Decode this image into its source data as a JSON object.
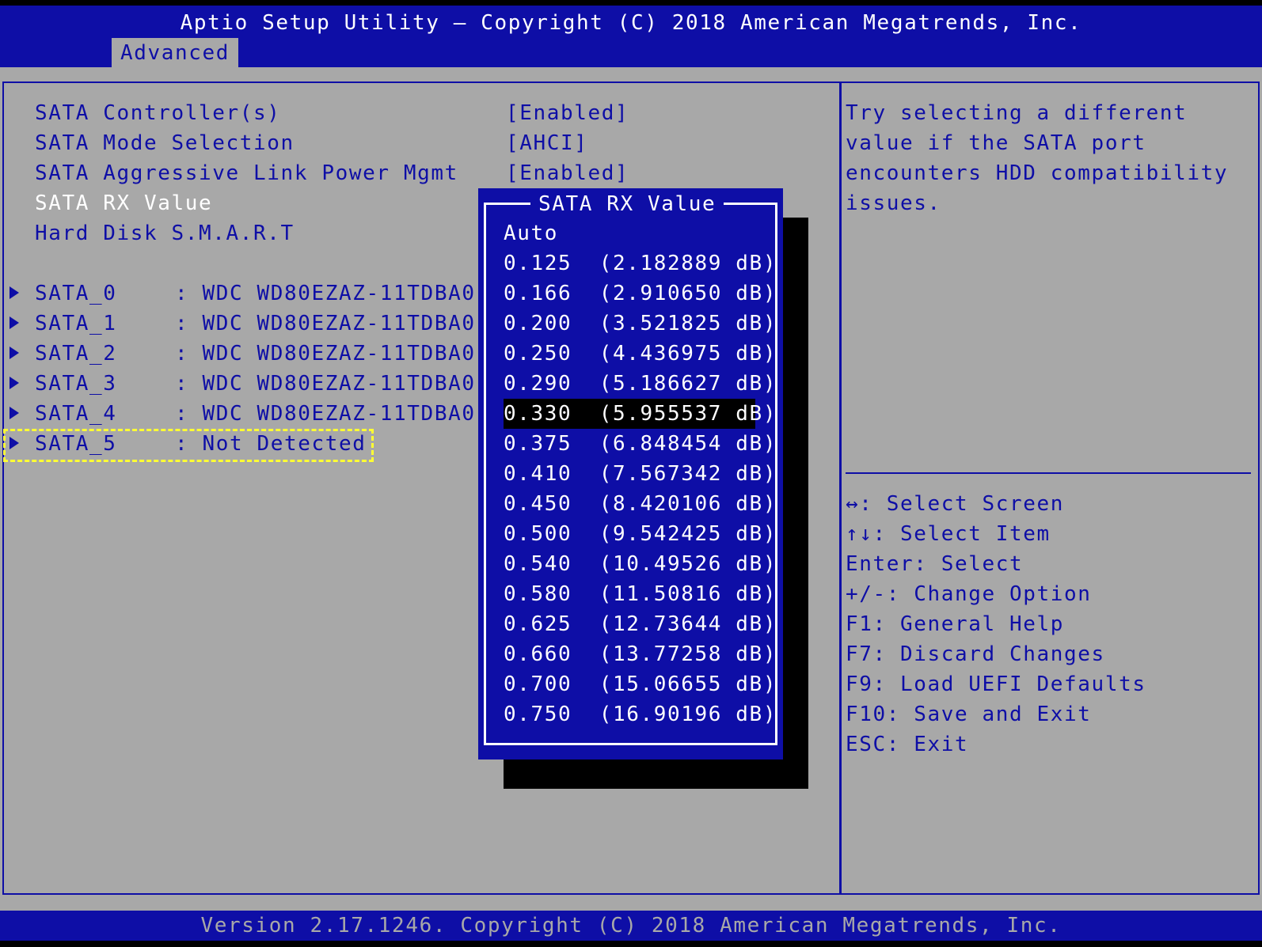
{
  "header": {
    "title": "Aptio Setup Utility – Copyright (C) 2018 American Megatrends, Inc.",
    "tab": "Advanced"
  },
  "settings": [
    {
      "label": "SATA Controller(s)",
      "value": "[Enabled]"
    },
    {
      "label": "SATA Mode Selection",
      "value": "[AHCI]"
    },
    {
      "label": "SATA Aggressive Link Power Mgmt",
      "value": "[Enabled]"
    },
    {
      "label": "SATA RX Value",
      "value": ""
    },
    {
      "label": "Hard Disk S.M.A.R.T",
      "value": ""
    }
  ],
  "ports": [
    {
      "name": "SATA_0",
      "device": ": WDC WD80EZAZ-11TDBA0"
    },
    {
      "name": "SATA_1",
      "device": ": WDC WD80EZAZ-11TDBA0"
    },
    {
      "name": "SATA_2",
      "device": ": WDC WD80EZAZ-11TDBA0"
    },
    {
      "name": "SATA_3",
      "device": ": WDC WD80EZAZ-11TDBA0"
    },
    {
      "name": "SATA_4",
      "device": ": WDC WD80EZAZ-11TDBA0"
    },
    {
      "name": "SATA_5",
      "device": ": Not Detected"
    }
  ],
  "popup": {
    "title": "SATA RX Value",
    "selected_index": 6,
    "options": [
      "Auto",
      "0.125  (2.182889 dB)",
      "0.166  (2.910650 dB)",
      "0.200  (3.521825 dB)",
      "0.250  (4.436975 dB)",
      "0.290  (5.186627 dB)",
      "0.330  (5.955537 dB)",
      "0.375  (6.848454 dB)",
      "0.410  (7.567342 dB)",
      "0.450  (8.420106 dB)",
      "0.500  (9.542425 dB)",
      "0.540  (10.49526 dB)",
      "0.580  (11.50816 dB)",
      "0.625  (12.73644 dB)",
      "0.660  (13.77258 dB)",
      "0.700  (15.06655 dB)",
      "0.750  (16.90196 dB)"
    ]
  },
  "help": {
    "lines": [
      "Try selecting a different",
      "value if the SATA port",
      "encounters HDD compatibility",
      "issues."
    ]
  },
  "keys": [
    "↔: Select Screen",
    "↑↓: Select Item",
    "Enter: Select",
    "+/-: Change Option",
    "F1: General Help",
    "F7: Discard Changes",
    "F9: Load UEFI Defaults",
    "F10: Save and Exit",
    "ESC: Exit"
  ],
  "footer": {
    "version": "Version 2.17.1246. Copyright (C) 2018 American Megatrends, Inc."
  },
  "colors": {
    "bios_blue": "#0e0ea6",
    "panel_gray": "#a8a8a8",
    "highlight_yellow": "#ffff33"
  }
}
